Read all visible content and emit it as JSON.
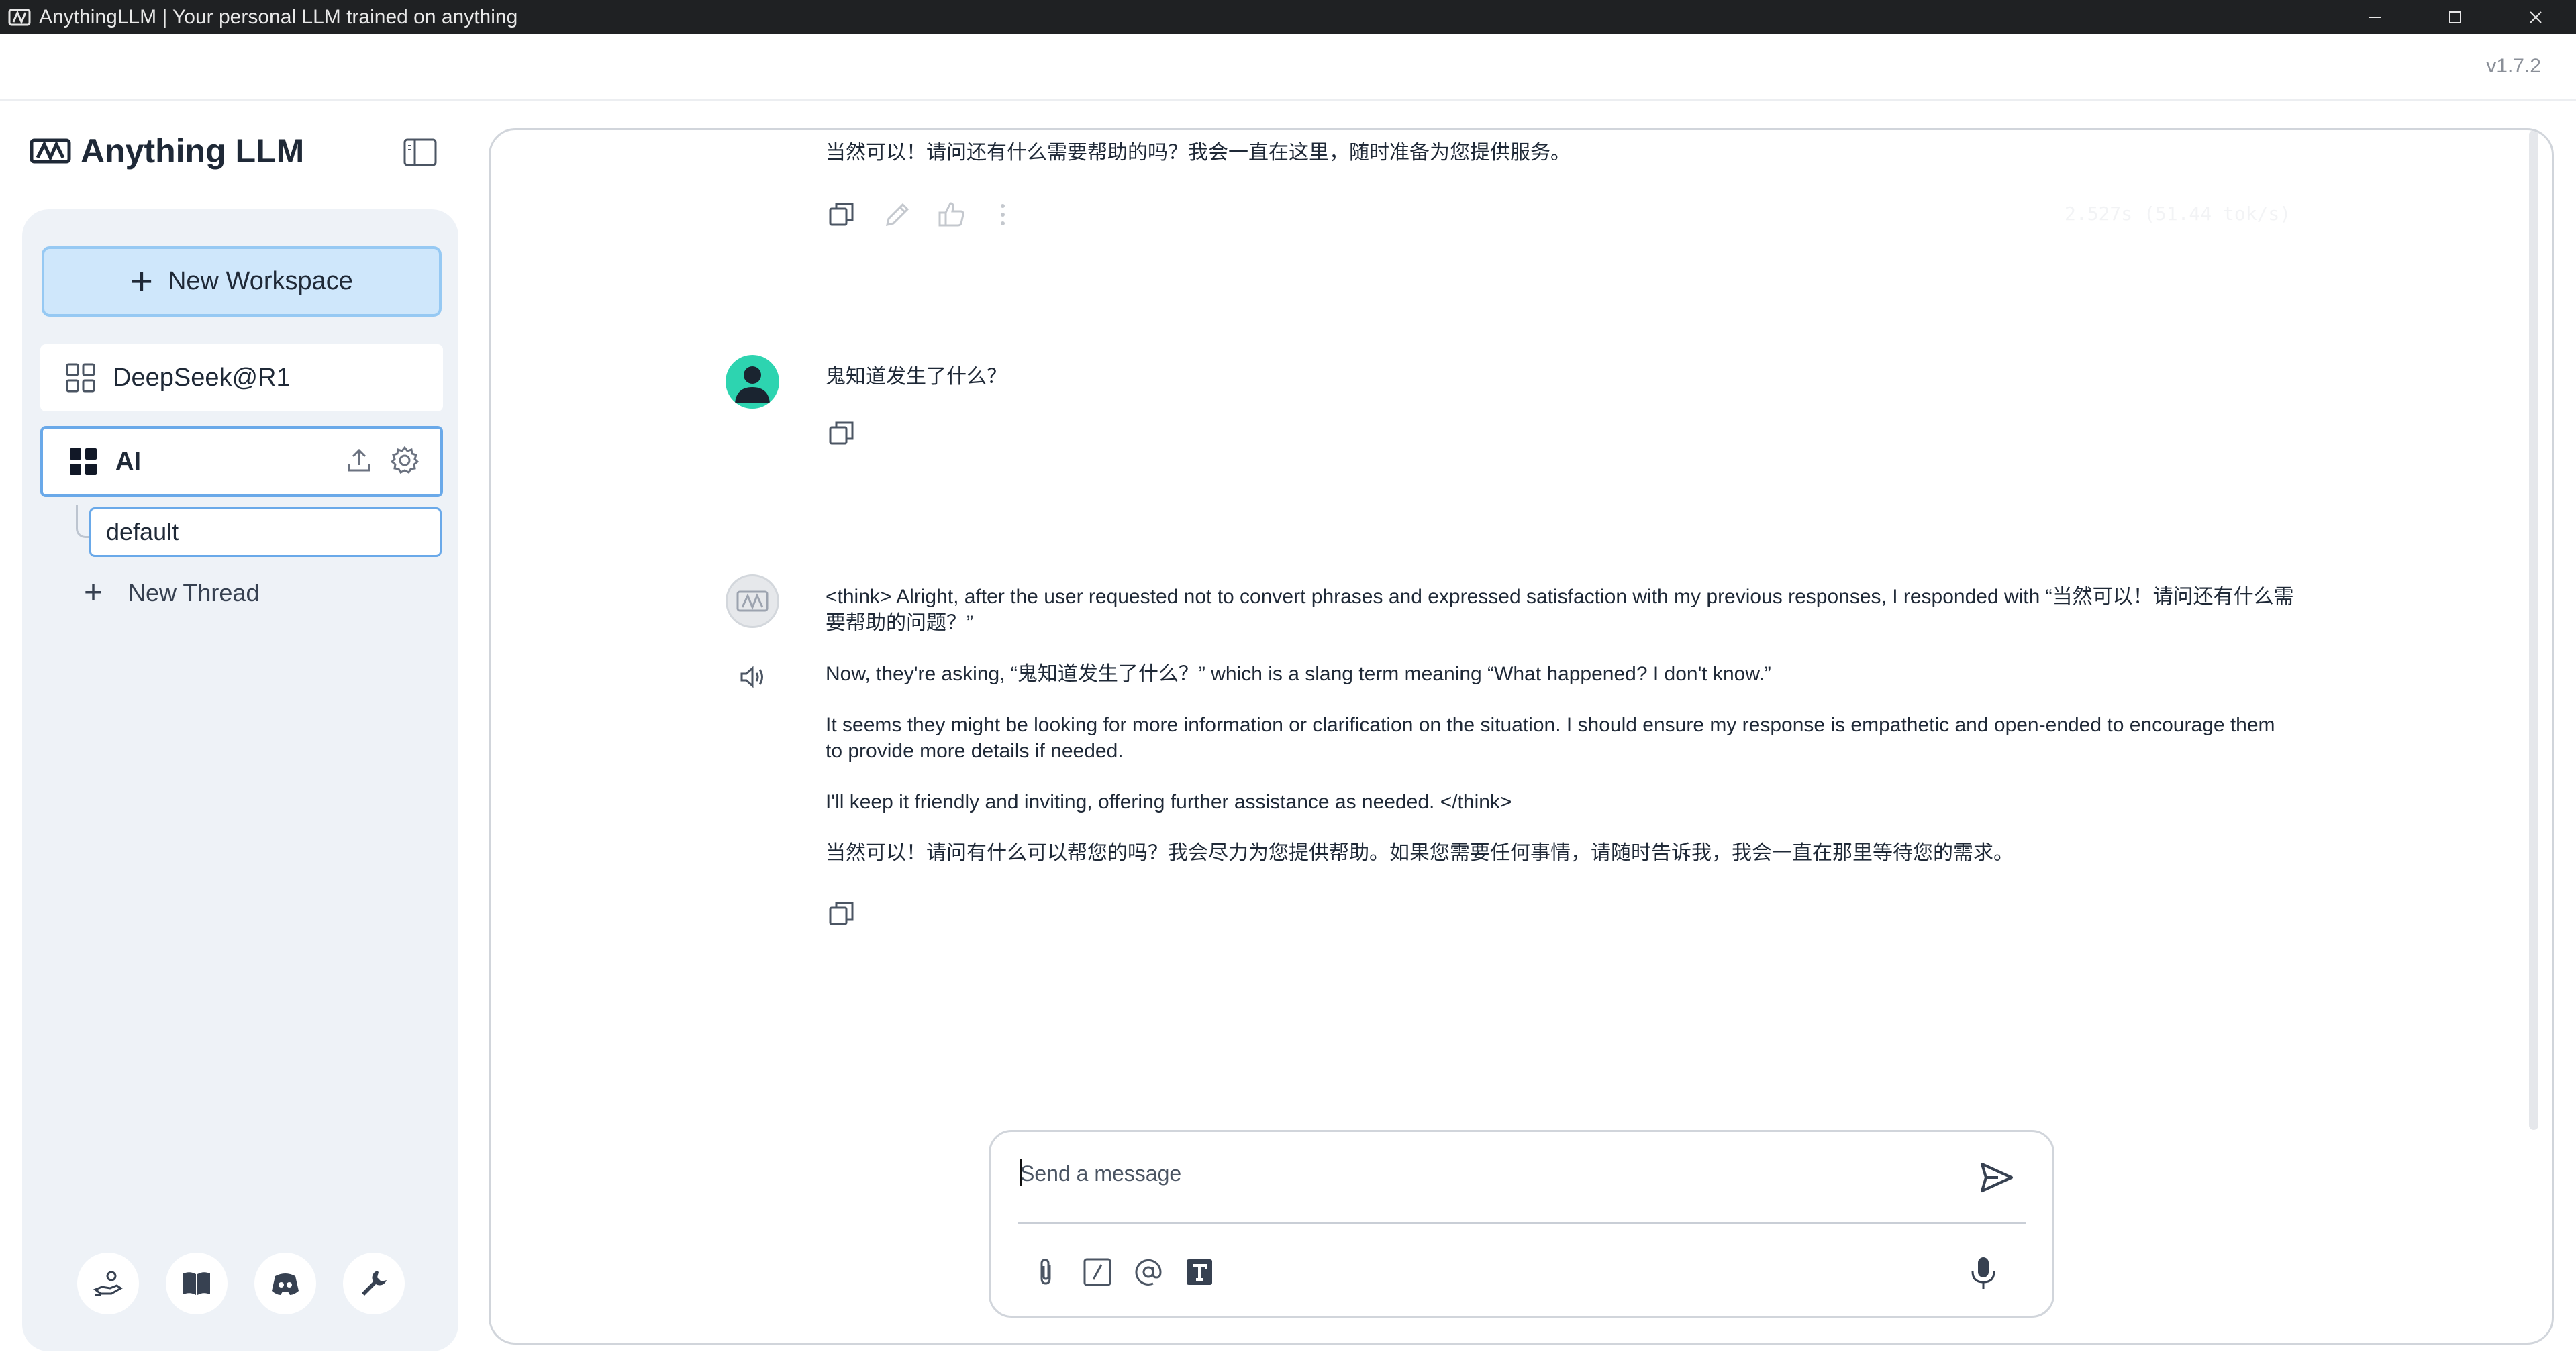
{
  "window": {
    "title": "AnythingLLM | Your personal LLM trained on anything",
    "app_icon": "anythingllm-logo-icon",
    "controls": [
      "minimize-icon",
      "maximize-icon",
      "close-icon"
    ]
  },
  "app": {
    "brand": "Anything LLM",
    "version": "v1.7.2"
  },
  "sidebar": {
    "new_workspace_label": "New Workspace",
    "workspaces": [
      {
        "label": "DeepSeek@R1",
        "icon": "grid-outline-icon",
        "active": false
      },
      {
        "label": "AI",
        "icon": "grid-filled-icon",
        "active": true
      }
    ],
    "threads": [
      {
        "label": "default",
        "active": true
      }
    ],
    "new_thread_label": "New Thread",
    "footer_icons": [
      "community-hub-icon",
      "docs-book-icon",
      "discord-icon",
      "settings-wrench-icon"
    ]
  },
  "chat": {
    "messages": [
      {
        "role": "assistant",
        "text": "当然可以！请问还有什么需要帮助的吗？我会一直在这里，随时准备为您提供服务。",
        "actions": [
          "copy-icon",
          "edit-icon",
          "thumbs-up-icon",
          "more-options-icon"
        ],
        "stats": "2.527s (51.44 tok/s)"
      },
      {
        "role": "user",
        "text": "鬼知道发生了什么？",
        "actions": [
          "copy-icon"
        ]
      },
      {
        "role": "assistant",
        "paragraphs": [
          "<think> Alright, after the user requested not to convert phrases and expressed satisfaction with my previous responses, I responded with “当然可以！请问还有什么需要帮助的问题？”",
          "Now, they're asking, “鬼知道发生了什么？” which is a slang term meaning “What happened? I don't know.”",
          "It seems they might be looking for more information or clarification on the situation. I should ensure my response is empathetic and open-ended to encourage them to provide more details if needed.",
          "I'll keep it friendly and inviting, offering further assistance as needed. </think>",
          "当然可以！请问有什么可以帮您的吗？我会尽力为您提供帮助。如果您需要任何事情，请随时告诉我，我会一直在那里等待您的需求。"
        ],
        "actions": [
          "copy-icon"
        ]
      }
    ]
  },
  "composer": {
    "placeholder": "Send a message",
    "value": "",
    "tools": [
      "attachment-icon",
      "slash-command-icon",
      "at-mention-icon",
      "text-size-icon"
    ]
  }
}
